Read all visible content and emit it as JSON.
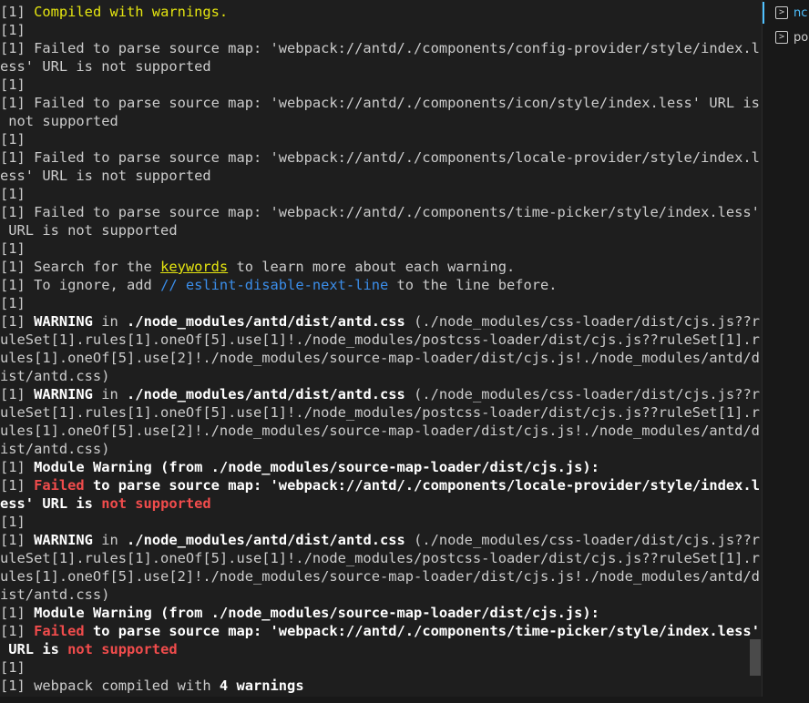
{
  "lines": [
    {
      "segments": [
        {
          "t": "[1] "
        },
        {
          "t": "Compiled with warnings.",
          "c": "yellow"
        }
      ]
    },
    {
      "segments": [
        {
          "t": "[1]"
        }
      ]
    },
    {
      "segments": [
        {
          "t": "[1] Failed to parse source map: 'webpack://antd/./components/config-provider/style/index.l"
        }
      ]
    },
    {
      "segments": [
        {
          "t": "ess' URL is not supported"
        }
      ]
    },
    {
      "segments": [
        {
          "t": "[1]"
        }
      ]
    },
    {
      "segments": [
        {
          "t": "[1] Failed to parse source map: 'webpack://antd/./components/icon/style/index.less' URL is"
        }
      ]
    },
    {
      "segments": [
        {
          "t": " not supported"
        }
      ]
    },
    {
      "segments": [
        {
          "t": "[1]"
        }
      ]
    },
    {
      "segments": [
        {
          "t": "[1] Failed to parse source map: 'webpack://antd/./components/locale-provider/style/index.l"
        }
      ]
    },
    {
      "segments": [
        {
          "t": "ess' URL is not supported"
        }
      ]
    },
    {
      "segments": [
        {
          "t": "[1]"
        }
      ]
    },
    {
      "segments": [
        {
          "t": "[1] Failed to parse source map: 'webpack://antd/./components/time-picker/style/index.less'"
        }
      ]
    },
    {
      "segments": [
        {
          "t": " URL is not supported"
        }
      ]
    },
    {
      "segments": [
        {
          "t": "[1]"
        }
      ]
    },
    {
      "segments": [
        {
          "t": "[1] Search for the "
        },
        {
          "t": "keywords",
          "c": "link"
        },
        {
          "t": " to learn more about each warning."
        }
      ]
    },
    {
      "segments": [
        {
          "t": "[1] To ignore, add "
        },
        {
          "t": "// eslint-disable-next-line",
          "c": "blue"
        },
        {
          "t": " to the line before."
        }
      ]
    },
    {
      "segments": [
        {
          "t": "[1]"
        }
      ]
    },
    {
      "segments": [
        {
          "t": "[1] "
        },
        {
          "t": "WARNING",
          "c": "yellow bold"
        },
        {
          "t": " in "
        },
        {
          "t": "./node_modules/antd/dist/antd.css",
          "c": "bold"
        },
        {
          "t": " (./node_modules/css-loader/dist/cjs.js??r"
        }
      ]
    },
    {
      "segments": [
        {
          "t": "uleSet[1].rules[1].oneOf[5].use[1]!./node_modules/postcss-loader/dist/cjs.js??ruleSet[1].r"
        }
      ]
    },
    {
      "segments": [
        {
          "t": "ules[1].oneOf[5].use[2]!./node_modules/source-map-loader/dist/cjs.js!./node_modules/antd/d"
        }
      ]
    },
    {
      "segments": [
        {
          "t": "ist/antd.css)"
        }
      ]
    },
    {
      "segments": [
        {
          "t": "[1] "
        },
        {
          "t": "WARNING",
          "c": "yellow bold"
        },
        {
          "t": " in "
        },
        {
          "t": "./node_modules/antd/dist/antd.css",
          "c": "bold"
        },
        {
          "t": " (./node_modules/css-loader/dist/cjs.js??r"
        }
      ]
    },
    {
      "segments": [
        {
          "t": "uleSet[1].rules[1].oneOf[5].use[1]!./node_modules/postcss-loader/dist/cjs.js??ruleSet[1].r"
        }
      ]
    },
    {
      "segments": [
        {
          "t": "ules[1].oneOf[5].use[2]!./node_modules/source-map-loader/dist/cjs.js!./node_modules/antd/d"
        }
      ]
    },
    {
      "segments": [
        {
          "t": "ist/antd.css)"
        }
      ]
    },
    {
      "segments": [
        {
          "t": "[1] "
        },
        {
          "t": "Module Warning (from ./node_modules/source-map-loader/dist/cjs.js):",
          "c": "bold"
        }
      ]
    },
    {
      "segments": [
        {
          "t": "[1] "
        },
        {
          "t": "Failed",
          "c": "red bold"
        },
        {
          "t": " to parse source map: 'webpack://antd/./components/locale-provider/style/index.l",
          "c": "bold"
        }
      ]
    },
    {
      "segments": [
        {
          "t": "ess' URL is ",
          "c": "bold"
        },
        {
          "t": "not supported",
          "c": "red bold"
        }
      ]
    },
    {
      "segments": [
        {
          "t": "[1]"
        }
      ]
    },
    {
      "segments": [
        {
          "t": "[1] "
        },
        {
          "t": "WARNING",
          "c": "yellow bold"
        },
        {
          "t": " in "
        },
        {
          "t": "./node_modules/antd/dist/antd.css",
          "c": "bold"
        },
        {
          "t": " (./node_modules/css-loader/dist/cjs.js??r"
        }
      ]
    },
    {
      "segments": [
        {
          "t": "uleSet[1].rules[1].oneOf[5].use[1]!./node_modules/postcss-loader/dist/cjs.js??ruleSet[1].r"
        }
      ]
    },
    {
      "segments": [
        {
          "t": "ules[1].oneOf[5].use[2]!./node_modules/source-map-loader/dist/cjs.js!./node_modules/antd/d"
        }
      ]
    },
    {
      "segments": [
        {
          "t": "ist/antd.css)"
        }
      ]
    },
    {
      "segments": [
        {
          "t": "[1] "
        },
        {
          "t": "Module Warning (from ./node_modules/source-map-loader/dist/cjs.js):",
          "c": "bold"
        }
      ]
    },
    {
      "segments": [
        {
          "t": "[1] "
        },
        {
          "t": "Failed",
          "c": "red bold"
        },
        {
          "t": " to parse source map: 'webpack://antd/./components/time-picker/style/index.less'",
          "c": "bold"
        }
      ]
    },
    {
      "segments": [
        {
          "t": " URL is ",
          "c": "bold"
        },
        {
          "t": "not supported",
          "c": "red bold"
        }
      ]
    },
    {
      "segments": [
        {
          "t": "[1]"
        }
      ]
    },
    {
      "segments": [
        {
          "t": "[1] webpack compiled with "
        },
        {
          "t": "4 warnings",
          "c": "yellow bold"
        }
      ]
    }
  ],
  "terminals": [
    {
      "label": "nc",
      "icon": "terminal-icon",
      "active": true
    },
    {
      "label": "po",
      "icon": "terminal-icon",
      "active": false
    }
  ],
  "colors": {
    "background": "#1e1e1e",
    "foreground": "#cccccc",
    "yellow": "#e5e510",
    "red": "#f14c4c",
    "blue": "#3b8eea",
    "accent": "#4fc1ff"
  }
}
